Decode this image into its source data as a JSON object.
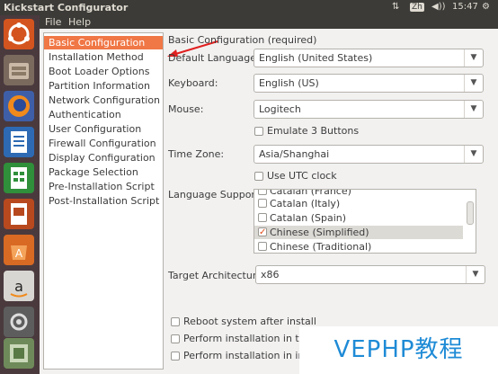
{
  "topbar": {
    "title": "Kickstart Configurator",
    "keyboard": "Zh",
    "time": "15:47"
  },
  "menubar": {
    "file": "File",
    "help": "Help"
  },
  "nav": {
    "items": [
      "Basic Configuration",
      "Installation Method",
      "Boot Loader Options",
      "Partition Information",
      "Network Configuration",
      "Authentication",
      "User Configuration",
      "Firewall Configuration",
      "Display Configuration",
      "Package Selection",
      "Pre-Installation Script",
      "Post-Installation Script"
    ],
    "selected_index": 0
  },
  "form": {
    "section_title": "Basic Configuration (required)",
    "default_language_label": "Default Language:",
    "default_language_value": "English (United States)",
    "keyboard_label": "Keyboard:",
    "keyboard_value": "English (US)",
    "mouse_label": "Mouse:",
    "mouse_value": "Logitech",
    "emulate_label": "Emulate 3 Buttons",
    "timezone_label": "Time Zone:",
    "timezone_value": "Asia/Shanghai",
    "utc_label": "Use UTC clock",
    "language_support_label": "Language Support:",
    "languages": [
      {
        "label": "Catalan (France)",
        "checked": false
      },
      {
        "label": "Catalan (Italy)",
        "checked": false
      },
      {
        "label": "Catalan (Spain)",
        "checked": false
      },
      {
        "label": "Chinese (Simplified)",
        "checked": true
      },
      {
        "label": "Chinese (Traditional)",
        "checked": false
      }
    ],
    "target_arch_label": "Target Architecture:",
    "target_arch_value": "x86",
    "reboot_label": "Reboot system after install",
    "text_mode_label": "Perform installation in text",
    "interactive_label": "Perform installation in inte"
  },
  "watermark": "VEPHP教程",
  "colors": {
    "accent": "#f07746",
    "panel_dark": "#3c3b37",
    "launcher": "#4a3a3e",
    "arrow": "#e02020"
  },
  "launcher_icons": [
    "ubuntu-dash-icon",
    "files-icon",
    "firefox-icon",
    "writer-icon",
    "calc-icon",
    "impress-icon",
    "software-center-icon",
    "amazon-icon",
    "system-settings-icon",
    "kickstart-icon",
    "trash-icon"
  ]
}
